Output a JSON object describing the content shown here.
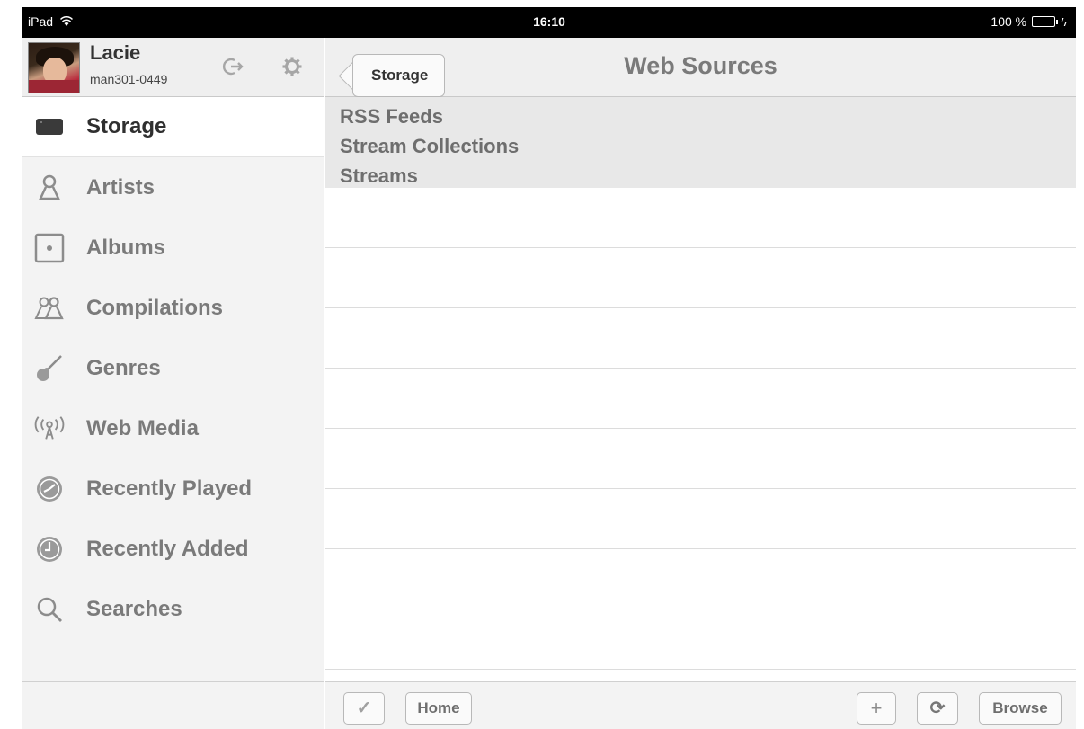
{
  "status_bar": {
    "device": "iPad",
    "time": "16:10",
    "battery": "100 %",
    "wifi_icon": "wifi-icon",
    "battery_icon": "battery-icon",
    "charging_icon": "charging-bolt-icon"
  },
  "profile": {
    "name": "Lacie",
    "id": "man301-0449",
    "avatar": "avatar-photo",
    "logout_icon": "logout-icon",
    "settings_icon": "gear-icon"
  },
  "sidebar": {
    "items": [
      {
        "label": "Storage",
        "icon": "storage-icon",
        "active": true
      },
      {
        "label": "Artists",
        "icon": "person-icon",
        "active": false
      },
      {
        "label": "Albums",
        "icon": "album-icon",
        "active": false
      },
      {
        "label": "Compilations",
        "icon": "people-icon",
        "active": false
      },
      {
        "label": "Genres",
        "icon": "guitar-icon",
        "active": false
      },
      {
        "label": "Web Media",
        "icon": "broadcast-icon",
        "active": false
      },
      {
        "label": "Recently Played",
        "icon": "clock-played-icon",
        "active": false
      },
      {
        "label": "Recently Added",
        "icon": "clock-added-icon",
        "active": false
      },
      {
        "label": "Searches",
        "icon": "search-icon",
        "active": false
      }
    ]
  },
  "navbar": {
    "back_label": "Storage",
    "title": "Web Sources"
  },
  "sources": [
    "RSS Feeds",
    "Stream Collections",
    "Streams"
  ],
  "toolbar": {
    "check_glyph": "✓",
    "home_label": "Home",
    "plus_glyph": "+",
    "refresh_glyph": "⟳",
    "browse_label": "Browse"
  },
  "colors": {
    "accent_battery": "#4cd964",
    "text_dark": "#2f2f2f",
    "text_muted": "#7a7a7a",
    "panel_bg": "#f3f3f3"
  }
}
